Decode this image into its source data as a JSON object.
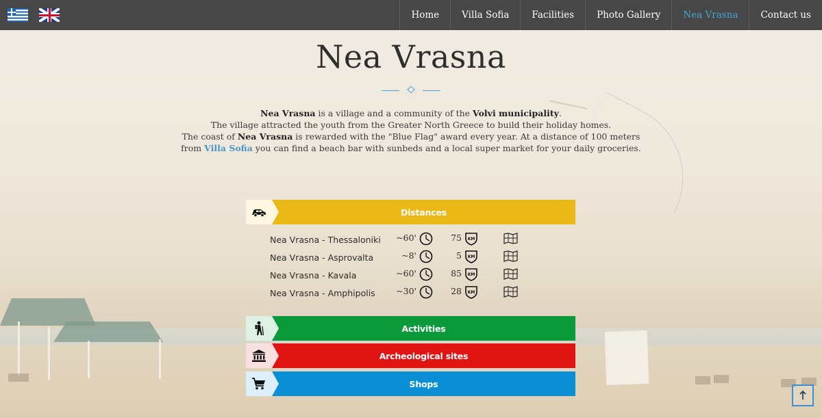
{
  "nav": {
    "flags": [
      "greek-flag-icon",
      "uk-flag-icon"
    ],
    "items": [
      {
        "label": "Home"
      },
      {
        "label": "Villa Sofia"
      },
      {
        "label": "Facilities"
      },
      {
        "label": "Photo Gallery"
      },
      {
        "label": "Nea Vrasna",
        "active": true
      },
      {
        "label": "Contact us"
      }
    ],
    "accent": "#4ca3d6"
  },
  "page": {
    "title": "Nea Vrasna",
    "intro": {
      "l1_b1": "Nea Vrasna",
      "l1_t1": " is a village and a community of the ",
      "l1_b2": "Volvi municipality",
      "l1_t2": ".",
      "l2": "The village attracted the youth from the Greater North Greece to build their holiday homes.",
      "l3_t1": "The coast of ",
      "l3_b1": "Nea Vrasna",
      "l3_t2": " is rewarded with the \"Blue Flag\" award every year. At a distance of 100 meters",
      "l4_t1": "from ",
      "l4_link": "Villa Sofia",
      "l4_t2": " you can find a beach bar with sunbeds and a local super market for your daily groceries."
    }
  },
  "panels": [
    {
      "label": "Distances",
      "icon": "car-icon",
      "color": "#eab817",
      "icon_bg": "#fdf6e0"
    },
    {
      "label": "Activities",
      "icon": "hiker-icon",
      "color": "#0a9a3b",
      "icon_bg": "#ddf2e4"
    },
    {
      "label": "Archeological sites",
      "icon": "museum-icon",
      "color": "#e11414",
      "icon_bg": "#fbe0e0"
    },
    {
      "label": "Shops",
      "icon": "shopping-cart-icon",
      "color": "#0a8fd4",
      "icon_bg": "#ddeffa"
    }
  ],
  "distances": [
    {
      "route": "Nea Vrasna - Thessaloniki",
      "time": "~60'",
      "km": "75"
    },
    {
      "route": "Nea Vrasna - Asprovalta",
      "time": "~8'",
      "km": "5"
    },
    {
      "route": "Nea Vrasna - Kavala",
      "time": "~60'",
      "km": "85"
    },
    {
      "route": "Nea Vrasna - Amphipolis",
      "time": "~30'",
      "km": "28"
    }
  ],
  "km_badge": "KM",
  "to_top_icon": "arrow-up-icon"
}
